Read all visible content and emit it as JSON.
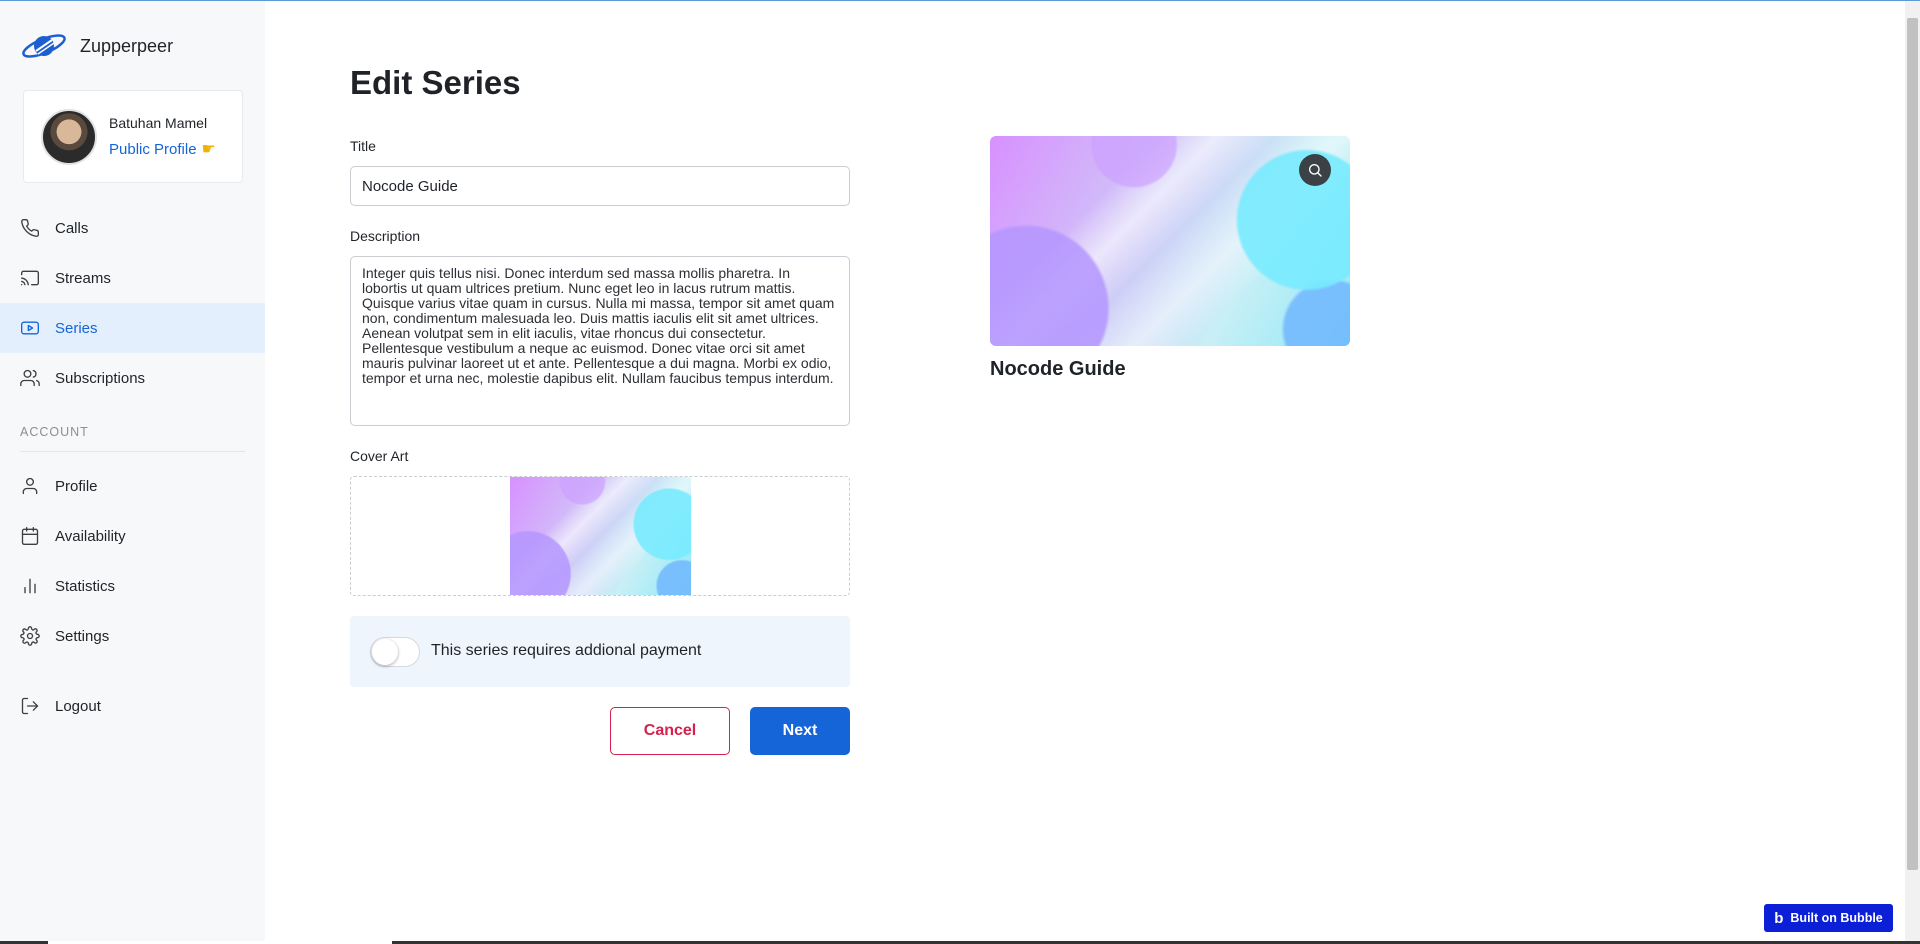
{
  "brand": {
    "name": "Zupperpeer"
  },
  "profile": {
    "name": "Batuhan Mamel",
    "link_label": "Public Profile"
  },
  "nav": {
    "main": [
      {
        "label": "Calls",
        "icon": "phone-icon"
      },
      {
        "label": "Streams",
        "icon": "cast-icon"
      },
      {
        "label": "Series",
        "icon": "play-icon",
        "active": true
      },
      {
        "label": "Subscriptions",
        "icon": "users-icon"
      }
    ],
    "section_label": "ACCOUNT",
    "account": [
      {
        "label": "Profile",
        "icon": "user-icon"
      },
      {
        "label": "Availability",
        "icon": "calendar-icon"
      },
      {
        "label": "Statistics",
        "icon": "bar-chart-icon"
      },
      {
        "label": "Settings",
        "icon": "gear-icon"
      },
      {
        "label": "Logout",
        "icon": "logout-icon"
      }
    ]
  },
  "form": {
    "heading": "Edit Series",
    "title_label": "Title",
    "title_value": "Nocode Guide",
    "description_label": "Description",
    "description_value": "Integer quis tellus nisi. Donec interdum sed massa mollis pharetra. In lobortis ut quam ultrices pretium. Nunc eget leo in lacus rutrum mattis. Quisque varius vitae quam in cursus. Nulla mi massa, tempor sit amet quam non, condimentum malesuada leo. Duis mattis iaculis elit sit amet ultrices. Aenean volutpat sem in elit iaculis, vitae rhoncus dui consectetur. Pellentesque vestibulum a neque ac euismod. Donec vitae orci sit amet mauris pulvinar laoreet ut et ante. Pellentesque a dui magna. Morbi ex odio, tempor et urna nec, molestie dapibus elit. Nullam faucibus tempus interdum.",
    "cover_label": "Cover Art",
    "payment_label": "This series requires addional payment",
    "payment_enabled": false,
    "cancel_label": "Cancel",
    "next_label": "Next"
  },
  "preview": {
    "title": "Nocode Guide"
  },
  "badge": {
    "label": "Built on Bubble"
  },
  "colors": {
    "accent": "#1565d8",
    "active_bg": "#e3effd",
    "danger": "#d6204e",
    "sidebar_bg": "#f7f8f9",
    "payment_bg": "#eef5fd",
    "bubble": "#0b1fd6"
  }
}
